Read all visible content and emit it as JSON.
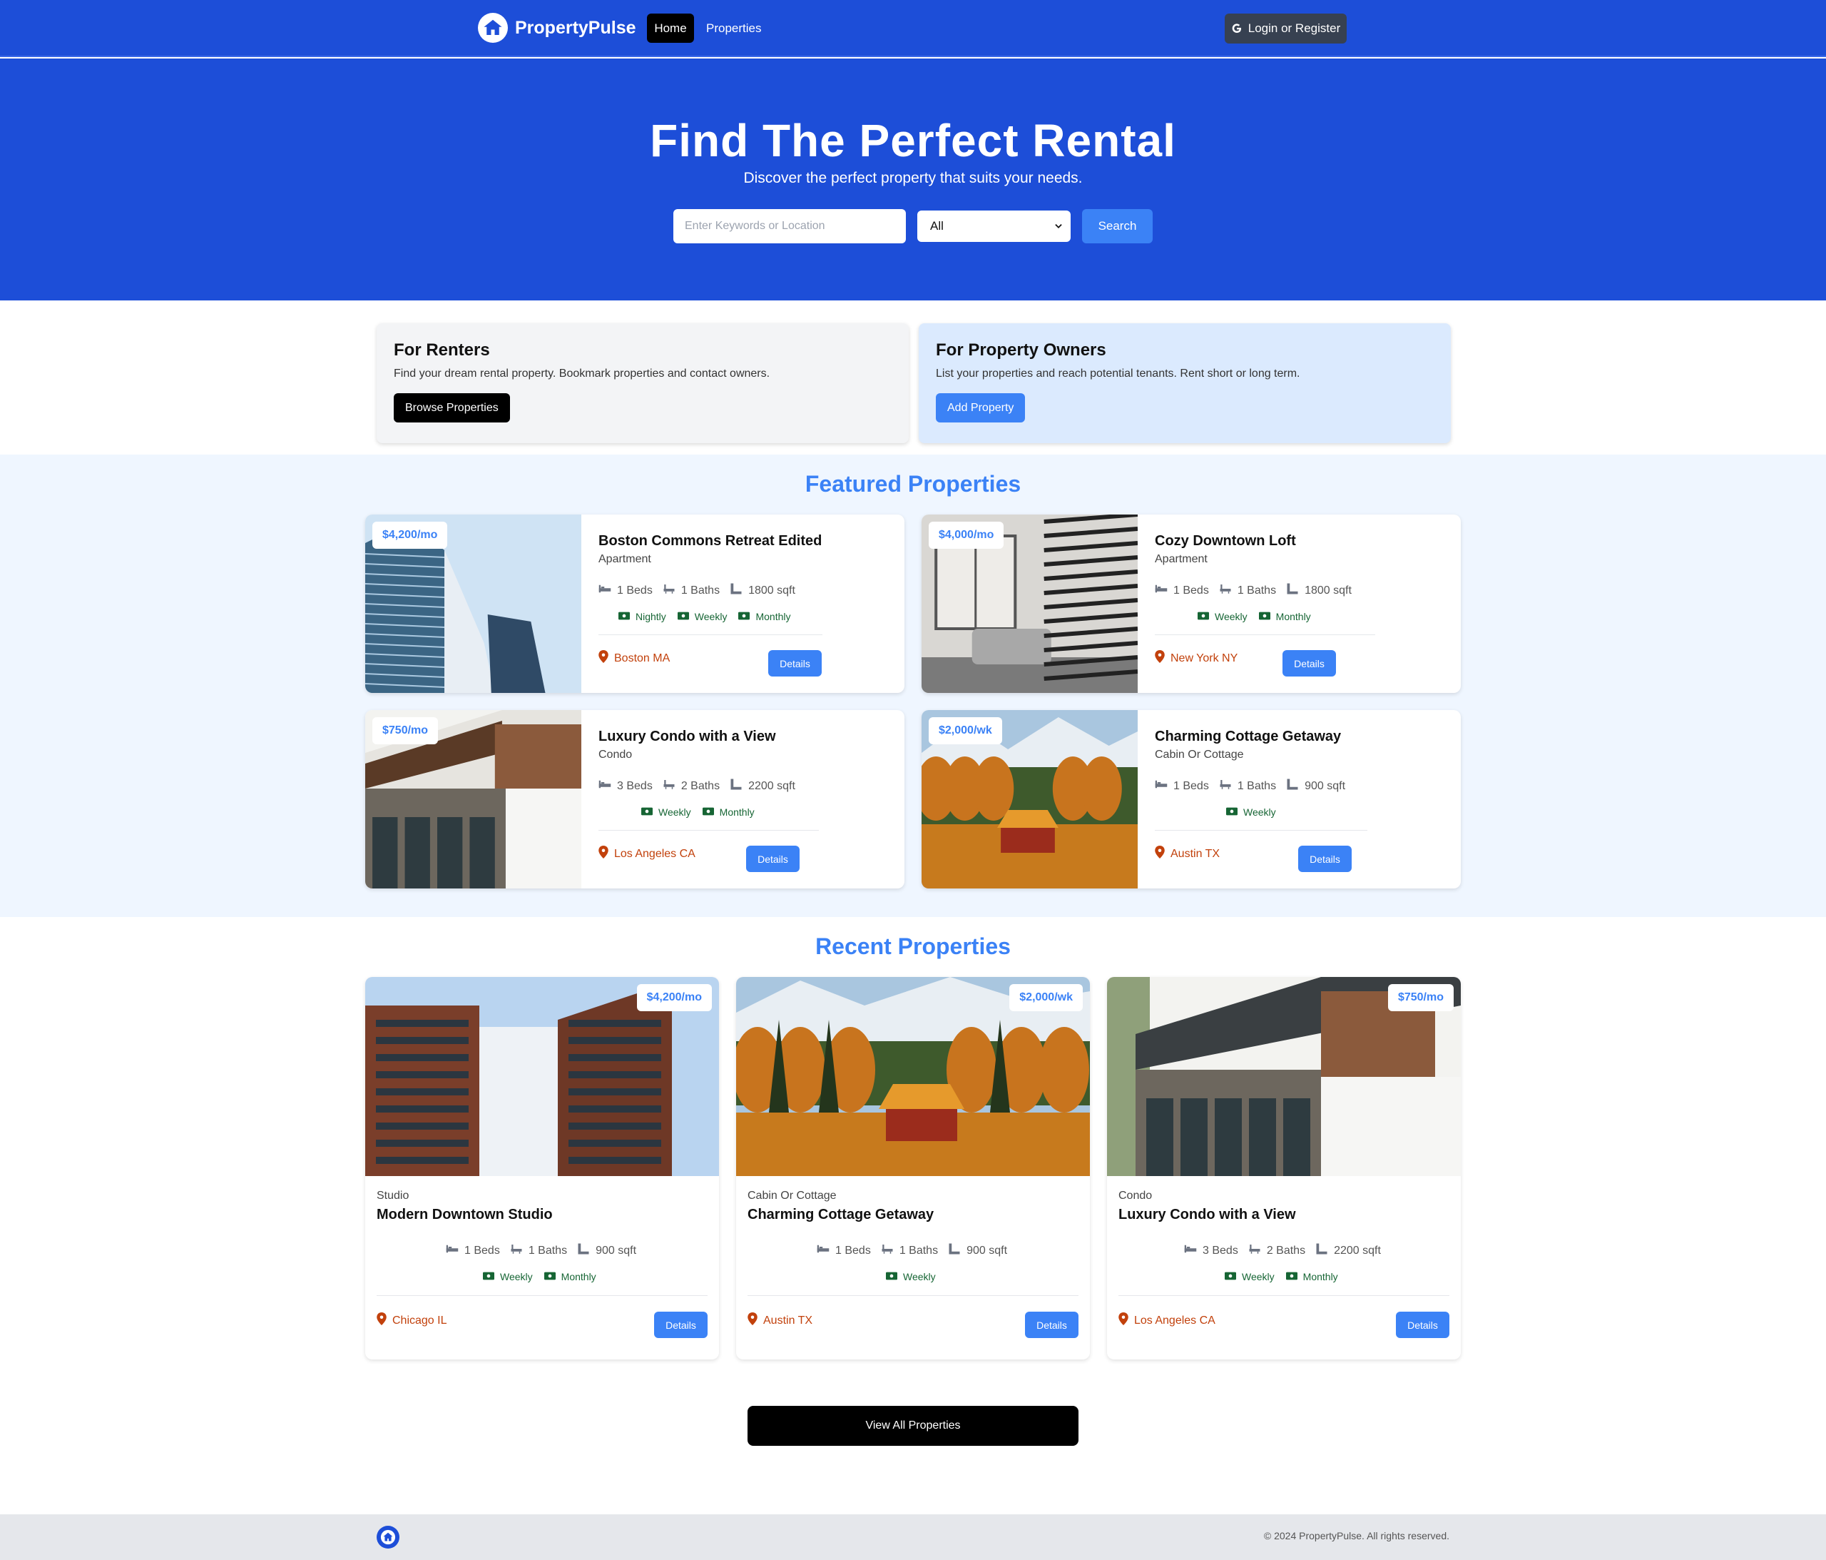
{
  "nav": {
    "brand": "PropertyPulse",
    "home": "Home",
    "properties": "Properties",
    "login": "Login or Register"
  },
  "hero": {
    "title": "Find The Perfect Rental",
    "subtitle": "Discover the perfect property that suits your needs.",
    "search_placeholder": "Enter Keywords or Location",
    "select_value": "All",
    "search_button": "Search"
  },
  "info": {
    "renters": {
      "title": "For Renters",
      "text": "Find your dream rental property. Bookmark properties and contact owners.",
      "button": "Browse Properties"
    },
    "owners": {
      "title": "For Property Owners",
      "text": "List your properties and reach potential tenants. Rent short or long term.",
      "button": "Add Property"
    }
  },
  "featured": {
    "title": "Featured Properties",
    "items": [
      {
        "price": "$4,200/mo",
        "name": "Boston Commons Retreat Edited",
        "type": "Apartment",
        "beds": "1 Beds",
        "baths": "1 Baths",
        "sqft": "1800 sqft",
        "rates": [
          "Nightly",
          "Weekly",
          "Monthly"
        ],
        "location": "Boston MA",
        "details": "Details"
      },
      {
        "price": "$4,000/mo",
        "name": "Cozy Downtown Loft",
        "type": "Apartment",
        "beds": "1 Beds",
        "baths": "1 Baths",
        "sqft": "1800 sqft",
        "rates": [
          "Weekly",
          "Monthly"
        ],
        "location": "New York NY",
        "details": "Details"
      },
      {
        "price": "$750/mo",
        "name": "Luxury Condo with a View",
        "type": "Condo",
        "beds": "3 Beds",
        "baths": "2 Baths",
        "sqft": "2200 sqft",
        "rates": [
          "Weekly",
          "Monthly"
        ],
        "location": "Los Angeles CA",
        "details": "Details"
      },
      {
        "price": "$2,000/wk",
        "name": "Charming Cottage Getaway",
        "type": "Cabin Or Cottage",
        "beds": "1 Beds",
        "baths": "1 Baths",
        "sqft": "900 sqft",
        "rates": [
          "Weekly"
        ],
        "location": "Austin TX",
        "details": "Details"
      }
    ]
  },
  "recent": {
    "title": "Recent Properties",
    "items": [
      {
        "price": "$4,200/mo",
        "name": "Modern Downtown Studio",
        "type": "Studio",
        "beds": "1 Beds",
        "baths": "1 Baths",
        "sqft": "900 sqft",
        "rates": [
          "Weekly",
          "Monthly"
        ],
        "location": "Chicago IL",
        "details": "Details"
      },
      {
        "price": "$2,000/wk",
        "name": "Charming Cottage Getaway",
        "type": "Cabin Or Cottage",
        "beds": "1 Beds",
        "baths": "1 Baths",
        "sqft": "900 sqft",
        "rates": [
          "Weekly"
        ],
        "location": "Austin TX",
        "details": "Details"
      },
      {
        "price": "$750/mo",
        "name": "Luxury Condo with a View",
        "type": "Condo",
        "beds": "3 Beds",
        "baths": "2 Baths",
        "sqft": "2200 sqft",
        "rates": [
          "Weekly",
          "Monthly"
        ],
        "location": "Los Angeles CA",
        "details": "Details"
      }
    ],
    "view_all": "View All Properties"
  },
  "footer": {
    "copyright": "© 2024 PropertyPulse. All rights reserved."
  },
  "colors": {
    "primary": "#1d4ed8",
    "accent": "#3b82f6",
    "location": "#c2410c",
    "rate": "#166534"
  }
}
